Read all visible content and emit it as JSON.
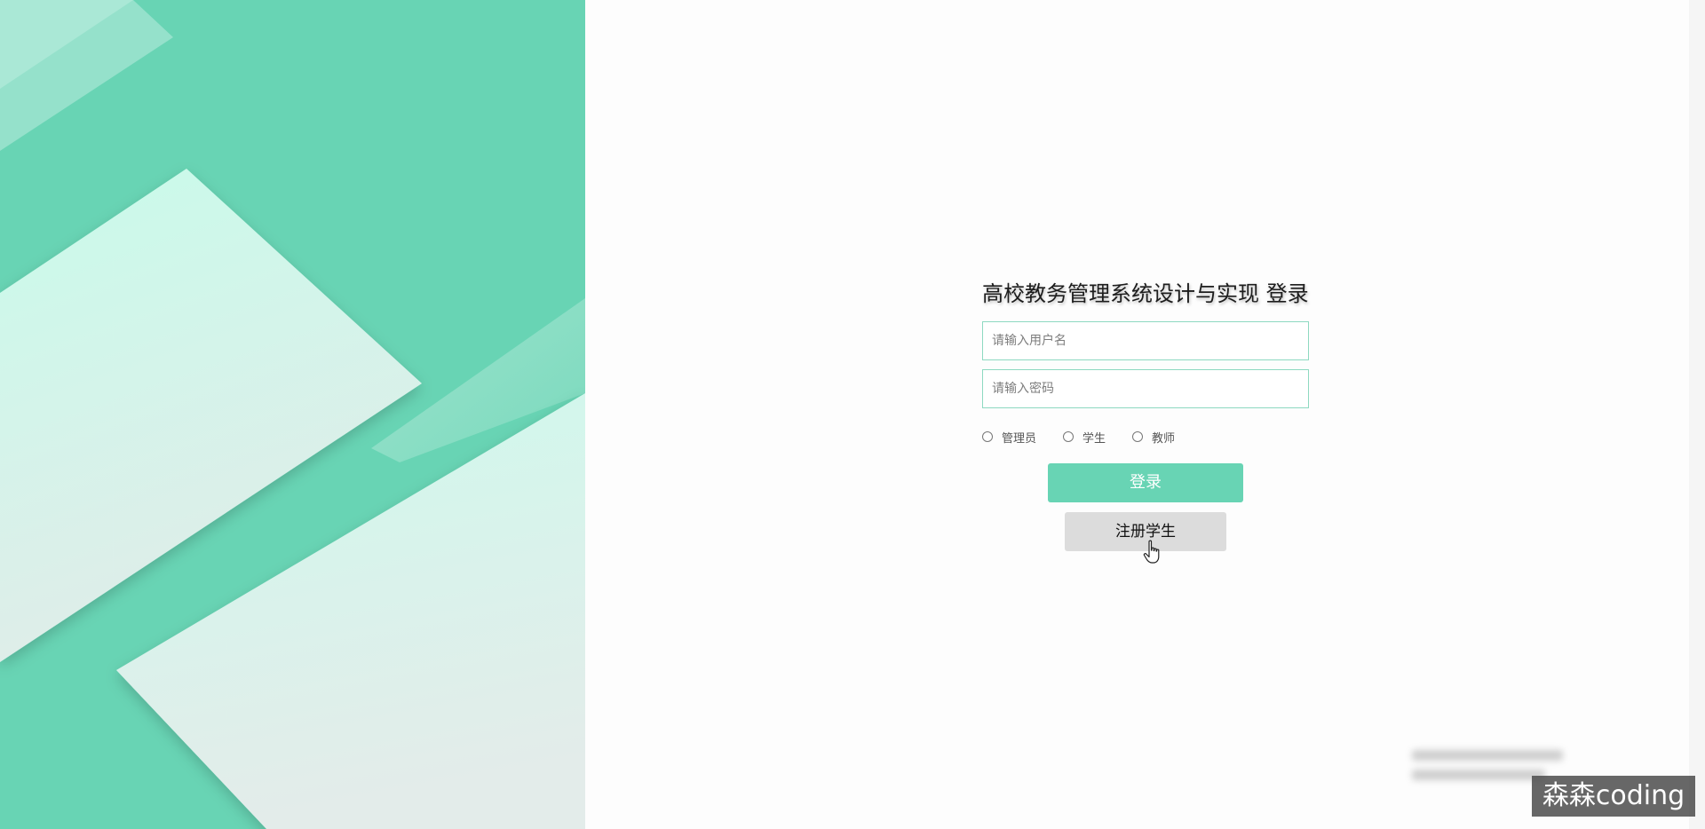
{
  "login": {
    "title": "高校教务管理系统设计与实现 登录",
    "username_placeholder": "请输入用户名",
    "password_placeholder": "请输入密码",
    "roles": [
      "管理员",
      "学生",
      "教师"
    ],
    "login_button": "登录",
    "register_button": "注册学生"
  },
  "watermark": {
    "text": "森森coding"
  },
  "colors": {
    "accent": "#68d4b4",
    "background": "#fdfdfd",
    "panel_light": "#d4f5ea",
    "register_button_bg": "#dcdcdc"
  },
  "icons": {
    "cursor": "hand-pointer-icon"
  }
}
